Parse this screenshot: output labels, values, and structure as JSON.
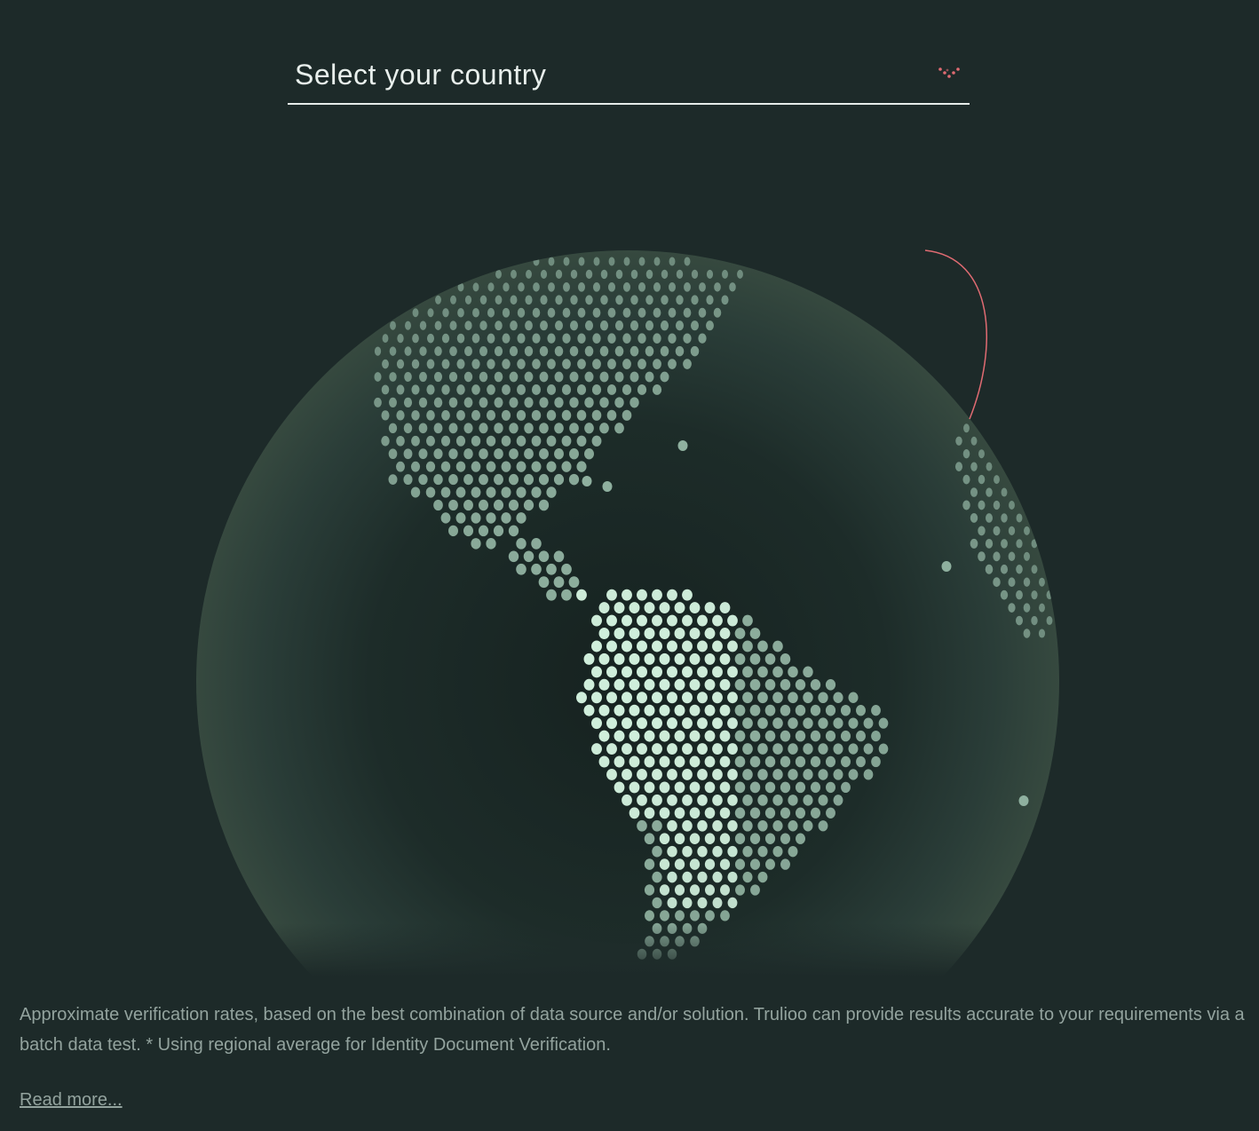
{
  "selector": {
    "label": "Select your country",
    "icon": "chevron-down-icon"
  },
  "globe": {
    "icon": "globe-dot-map"
  },
  "footer": {
    "disclaimer": "Approximate verification rates, based on the best combination of data source and/or solution. Trulioo can provide results accurate to your requirements via a batch data test. * Using regional average for Identity Document Verification.",
    "read_more": "Read more..."
  },
  "colors": {
    "background": "#1d2a29",
    "accent": "#e06b72",
    "dot": "#8fb09f",
    "dot_bright": "#dff5e6",
    "text": "#93a39e"
  }
}
